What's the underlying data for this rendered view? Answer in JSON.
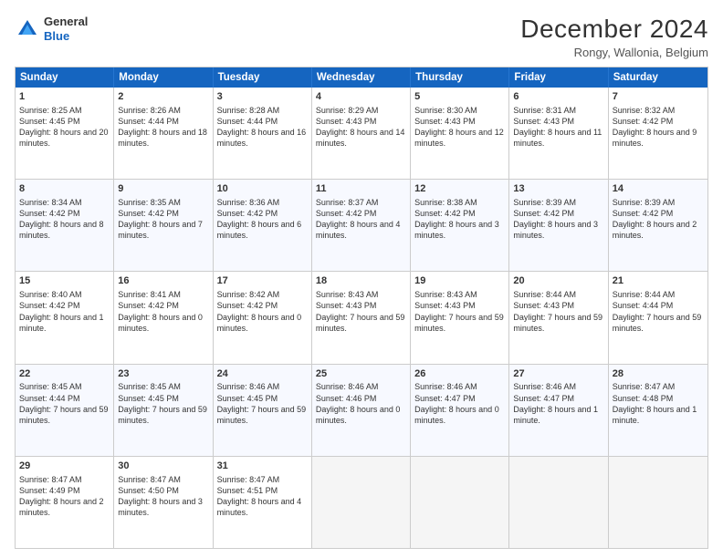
{
  "header": {
    "logo": {
      "general": "General",
      "blue": "Blue"
    },
    "title": "December 2024",
    "location": "Rongy, Wallonia, Belgium"
  },
  "calendar": {
    "days": [
      "Sunday",
      "Monday",
      "Tuesday",
      "Wednesday",
      "Thursday",
      "Friday",
      "Saturday"
    ],
    "rows": [
      [
        {
          "num": "1",
          "sunrise": "Sunrise: 8:25 AM",
          "sunset": "Sunset: 4:45 PM",
          "daylight": "Daylight: 8 hours and 20 minutes."
        },
        {
          "num": "2",
          "sunrise": "Sunrise: 8:26 AM",
          "sunset": "Sunset: 4:44 PM",
          "daylight": "Daylight: 8 hours and 18 minutes."
        },
        {
          "num": "3",
          "sunrise": "Sunrise: 8:28 AM",
          "sunset": "Sunset: 4:44 PM",
          "daylight": "Daylight: 8 hours and 16 minutes."
        },
        {
          "num": "4",
          "sunrise": "Sunrise: 8:29 AM",
          "sunset": "Sunset: 4:43 PM",
          "daylight": "Daylight: 8 hours and 14 minutes."
        },
        {
          "num": "5",
          "sunrise": "Sunrise: 8:30 AM",
          "sunset": "Sunset: 4:43 PM",
          "daylight": "Daylight: 8 hours and 12 minutes."
        },
        {
          "num": "6",
          "sunrise": "Sunrise: 8:31 AM",
          "sunset": "Sunset: 4:43 PM",
          "daylight": "Daylight: 8 hours and 11 minutes."
        },
        {
          "num": "7",
          "sunrise": "Sunrise: 8:32 AM",
          "sunset": "Sunset: 4:42 PM",
          "daylight": "Daylight: 8 hours and 9 minutes."
        }
      ],
      [
        {
          "num": "8",
          "sunrise": "Sunrise: 8:34 AM",
          "sunset": "Sunset: 4:42 PM",
          "daylight": "Daylight: 8 hours and 8 minutes."
        },
        {
          "num": "9",
          "sunrise": "Sunrise: 8:35 AM",
          "sunset": "Sunset: 4:42 PM",
          "daylight": "Daylight: 8 hours and 7 minutes."
        },
        {
          "num": "10",
          "sunrise": "Sunrise: 8:36 AM",
          "sunset": "Sunset: 4:42 PM",
          "daylight": "Daylight: 8 hours and 6 minutes."
        },
        {
          "num": "11",
          "sunrise": "Sunrise: 8:37 AM",
          "sunset": "Sunset: 4:42 PM",
          "daylight": "Daylight: 8 hours and 4 minutes."
        },
        {
          "num": "12",
          "sunrise": "Sunrise: 8:38 AM",
          "sunset": "Sunset: 4:42 PM",
          "daylight": "Daylight: 8 hours and 3 minutes."
        },
        {
          "num": "13",
          "sunrise": "Sunrise: 8:39 AM",
          "sunset": "Sunset: 4:42 PM",
          "daylight": "Daylight: 8 hours and 3 minutes."
        },
        {
          "num": "14",
          "sunrise": "Sunrise: 8:39 AM",
          "sunset": "Sunset: 4:42 PM",
          "daylight": "Daylight: 8 hours and 2 minutes."
        }
      ],
      [
        {
          "num": "15",
          "sunrise": "Sunrise: 8:40 AM",
          "sunset": "Sunset: 4:42 PM",
          "daylight": "Daylight: 8 hours and 1 minute."
        },
        {
          "num": "16",
          "sunrise": "Sunrise: 8:41 AM",
          "sunset": "Sunset: 4:42 PM",
          "daylight": "Daylight: 8 hours and 0 minutes."
        },
        {
          "num": "17",
          "sunrise": "Sunrise: 8:42 AM",
          "sunset": "Sunset: 4:42 PM",
          "daylight": "Daylight: 8 hours and 0 minutes."
        },
        {
          "num": "18",
          "sunrise": "Sunrise: 8:43 AM",
          "sunset": "Sunset: 4:43 PM",
          "daylight": "Daylight: 7 hours and 59 minutes."
        },
        {
          "num": "19",
          "sunrise": "Sunrise: 8:43 AM",
          "sunset": "Sunset: 4:43 PM",
          "daylight": "Daylight: 7 hours and 59 minutes."
        },
        {
          "num": "20",
          "sunrise": "Sunrise: 8:44 AM",
          "sunset": "Sunset: 4:43 PM",
          "daylight": "Daylight: 7 hours and 59 minutes."
        },
        {
          "num": "21",
          "sunrise": "Sunrise: 8:44 AM",
          "sunset": "Sunset: 4:44 PM",
          "daylight": "Daylight: 7 hours and 59 minutes."
        }
      ],
      [
        {
          "num": "22",
          "sunrise": "Sunrise: 8:45 AM",
          "sunset": "Sunset: 4:44 PM",
          "daylight": "Daylight: 7 hours and 59 minutes."
        },
        {
          "num": "23",
          "sunrise": "Sunrise: 8:45 AM",
          "sunset": "Sunset: 4:45 PM",
          "daylight": "Daylight: 7 hours and 59 minutes."
        },
        {
          "num": "24",
          "sunrise": "Sunrise: 8:46 AM",
          "sunset": "Sunset: 4:45 PM",
          "daylight": "Daylight: 7 hours and 59 minutes."
        },
        {
          "num": "25",
          "sunrise": "Sunrise: 8:46 AM",
          "sunset": "Sunset: 4:46 PM",
          "daylight": "Daylight: 8 hours and 0 minutes."
        },
        {
          "num": "26",
          "sunrise": "Sunrise: 8:46 AM",
          "sunset": "Sunset: 4:47 PM",
          "daylight": "Daylight: 8 hours and 0 minutes."
        },
        {
          "num": "27",
          "sunrise": "Sunrise: 8:46 AM",
          "sunset": "Sunset: 4:47 PM",
          "daylight": "Daylight: 8 hours and 1 minute."
        },
        {
          "num": "28",
          "sunrise": "Sunrise: 8:47 AM",
          "sunset": "Sunset: 4:48 PM",
          "daylight": "Daylight: 8 hours and 1 minute."
        }
      ],
      [
        {
          "num": "29",
          "sunrise": "Sunrise: 8:47 AM",
          "sunset": "Sunset: 4:49 PM",
          "daylight": "Daylight: 8 hours and 2 minutes."
        },
        {
          "num": "30",
          "sunrise": "Sunrise: 8:47 AM",
          "sunset": "Sunset: 4:50 PM",
          "daylight": "Daylight: 8 hours and 3 minutes."
        },
        {
          "num": "31",
          "sunrise": "Sunrise: 8:47 AM",
          "sunset": "Sunset: 4:51 PM",
          "daylight": "Daylight: 8 hours and 4 minutes."
        },
        null,
        null,
        null,
        null
      ]
    ]
  }
}
